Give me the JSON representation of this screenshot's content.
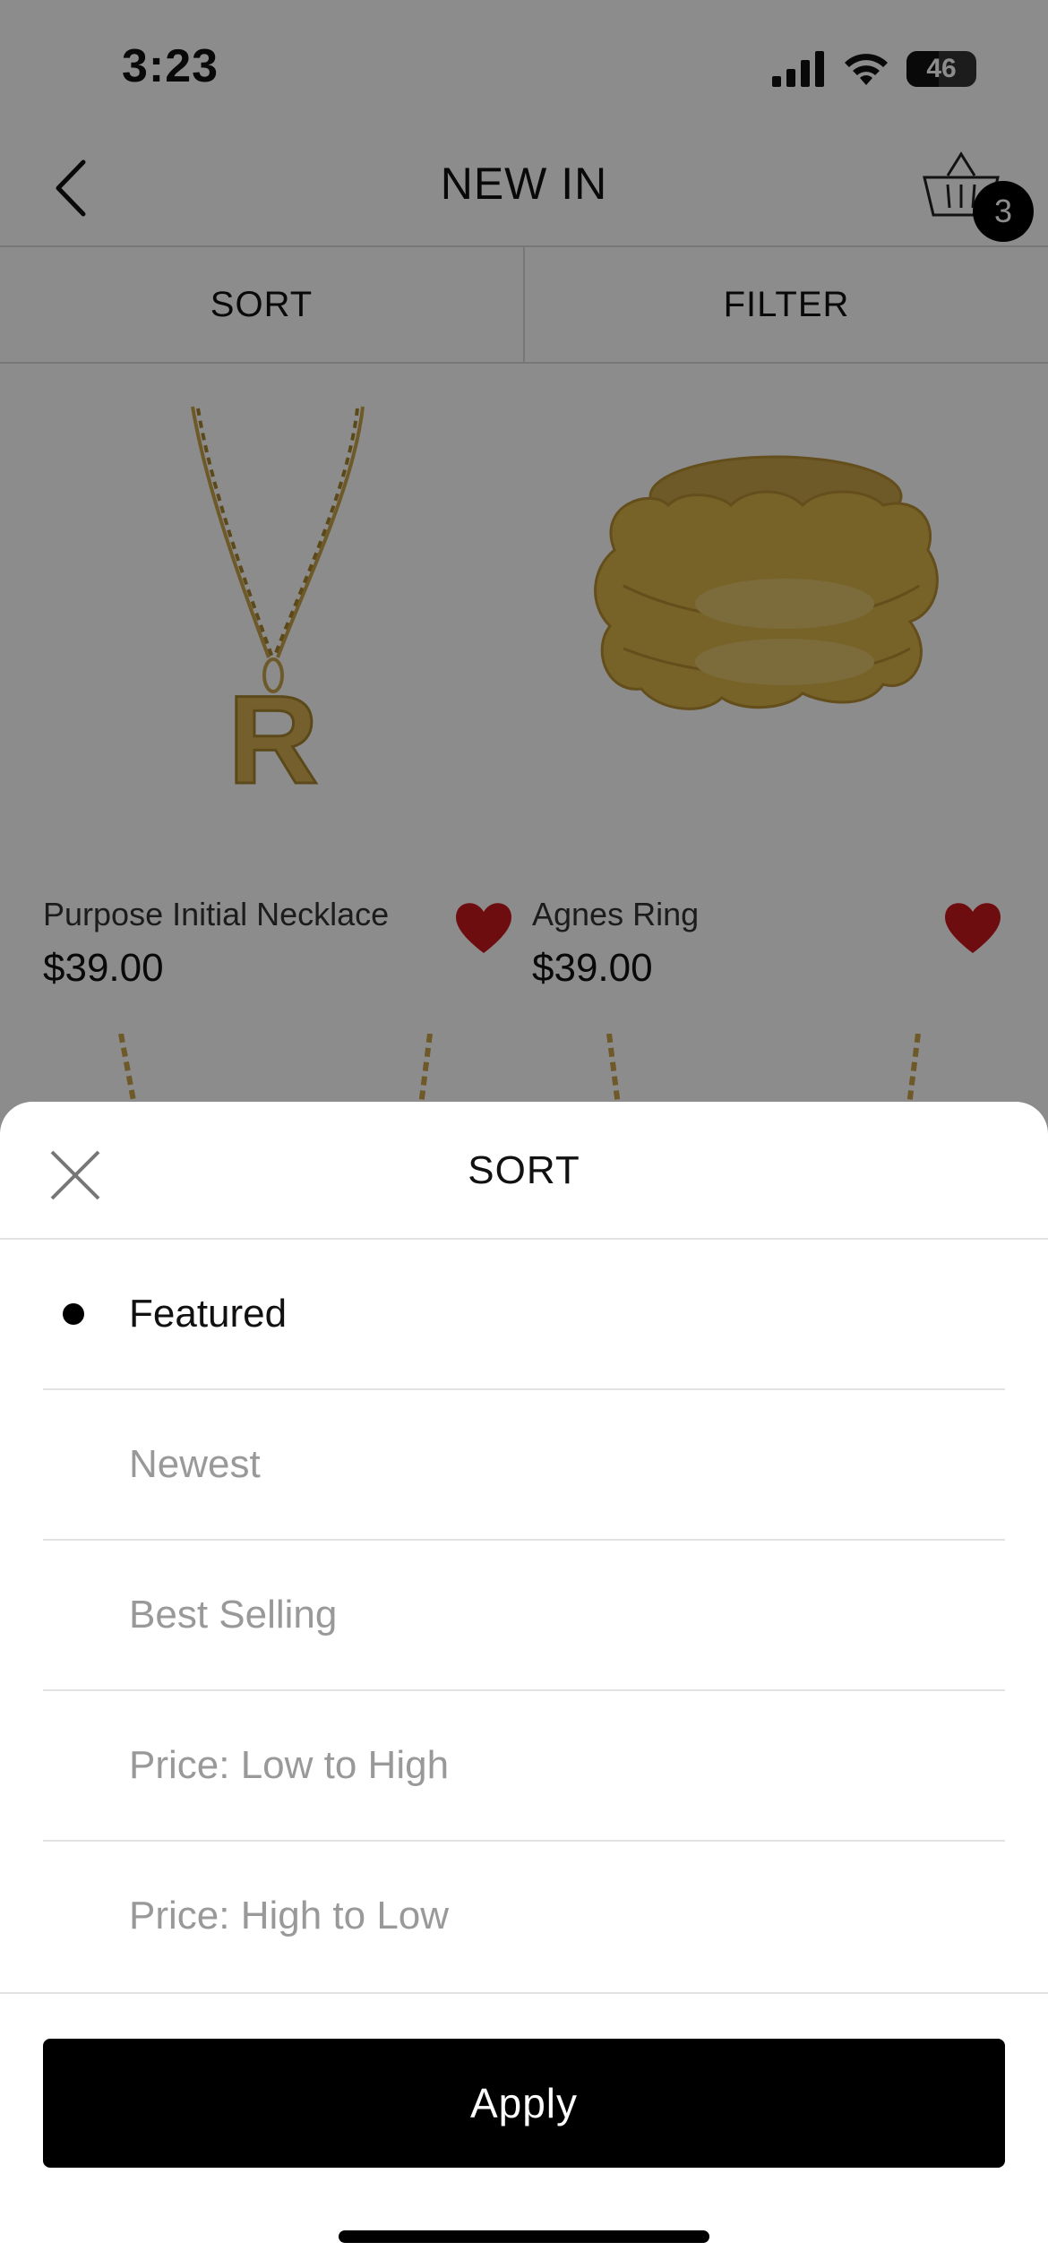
{
  "status_bar": {
    "time": "3:23",
    "battery": "46",
    "battery_level": 0.46,
    "icons": [
      "signal-icon",
      "wifi-icon",
      "battery-icon"
    ]
  },
  "nav": {
    "title": "NEW IN",
    "back_icon": "chevron-left-icon",
    "cart_icon": "basket-icon",
    "cart_count": "3"
  },
  "toolbar": {
    "sort_label": "SORT",
    "filter_label": "FILTER"
  },
  "products": [
    {
      "name": "Purpose Initial Necklace",
      "price": "$39.00",
      "favorited": true,
      "image": "letter-r-pendant-necklace"
    },
    {
      "name": "Agnes Ring",
      "price": "$39.00",
      "favorited": true,
      "image": "gold-braided-ring"
    }
  ],
  "sort_sheet": {
    "title": "SORT",
    "close_icon": "close-icon",
    "options": [
      {
        "label": "Featured",
        "selected": true
      },
      {
        "label": "Newest",
        "selected": false
      },
      {
        "label": "Best Selling",
        "selected": false
      },
      {
        "label": "Price: Low to High",
        "selected": false
      },
      {
        "label": "Price: High to Low",
        "selected": false
      }
    ],
    "apply_label": "Apply"
  },
  "colors": {
    "accent": "#000000",
    "heart": "#c8181e",
    "gold": "#d9b24a",
    "muted_text": "#999999"
  }
}
